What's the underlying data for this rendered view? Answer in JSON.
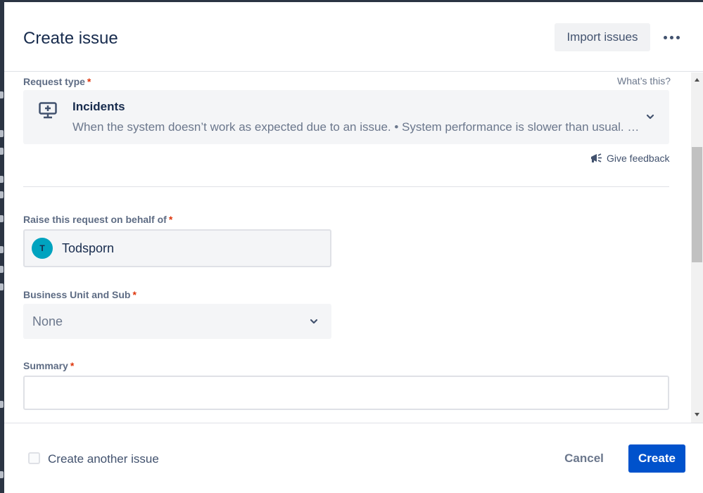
{
  "header": {
    "title": "Create issue",
    "import_label": "Import issues",
    "more_icon": "more-horizontal-icon"
  },
  "request_type": {
    "label": "Request type",
    "required_mark": "*",
    "whats_this": "What’s this?",
    "name": "Incidents",
    "description": "When the system doesn’t work as expected due to an issue. • System performance is slower than usual. • The website is not loading properly",
    "icon": "monitor-plus-icon"
  },
  "feedback": {
    "label": "Give feedback",
    "icon": "megaphone-icon"
  },
  "behalf": {
    "label": "Raise this request on behalf of",
    "required_mark": "*",
    "avatar_initial": "T",
    "user_name": "Todsporn"
  },
  "business_unit": {
    "label": "Business Unit and Sub",
    "required_mark": "*",
    "value": "None"
  },
  "summary": {
    "label": "Summary",
    "required_mark": "*",
    "value": ""
  },
  "footer": {
    "create_another_label": "Create another issue",
    "cancel_label": "Cancel",
    "create_label": "Create"
  },
  "colors": {
    "primary": "#0052cc",
    "required": "#de350b",
    "avatar": "#00a3bf"
  }
}
